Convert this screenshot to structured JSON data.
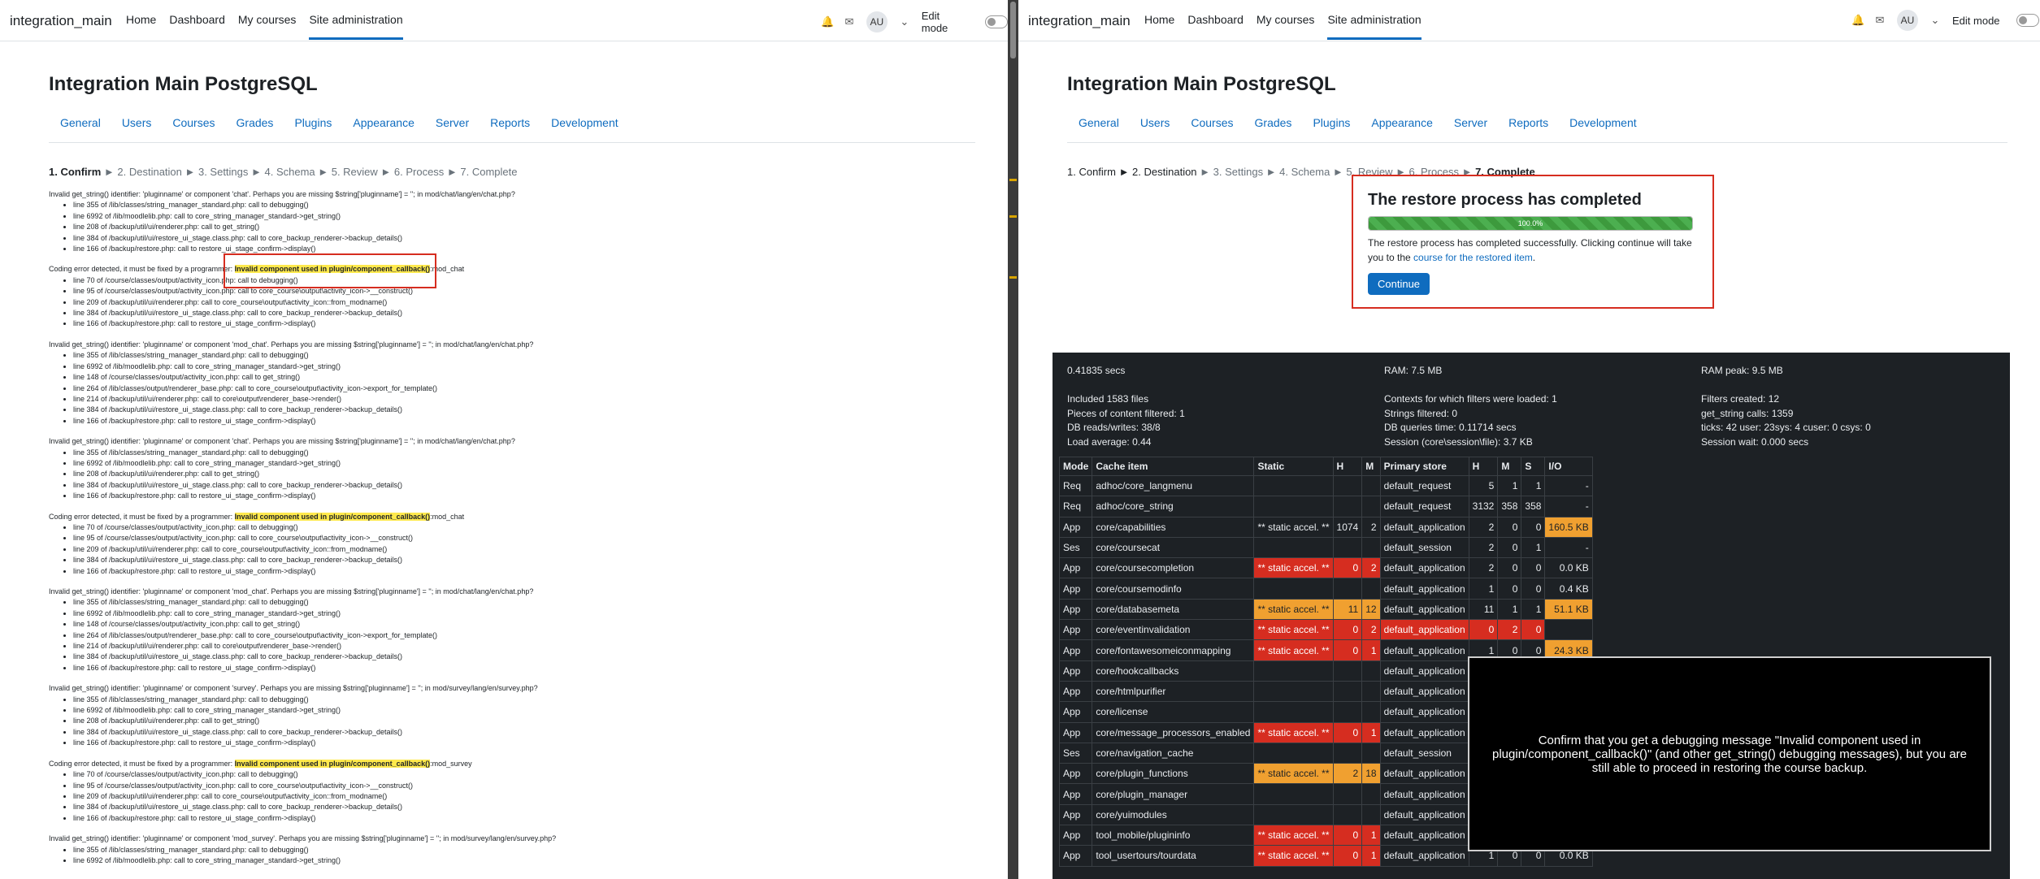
{
  "navbar": {
    "brand": "integration_main",
    "items": [
      "Home",
      "Dashboard",
      "My courses",
      "Site administration"
    ],
    "avatar": "AU",
    "edit_mode": "Edit mode"
  },
  "page_title": "Integration Main PostgreSQL",
  "admin_tabs": [
    "General",
    "Users",
    "Courses",
    "Grades",
    "Plugins",
    "Appearance",
    "Server",
    "Reports",
    "Development"
  ],
  "steps_left": {
    "current": "1. Confirm",
    "rest": " ► 2. Destination ► 3. Settings ► 4. Schema ► 5. Review ► 6. Process ► 7. Complete"
  },
  "steps_right": {
    "done": "1. Confirm ► 2. Destination",
    "rest": " ► 3. Settings ► 4. Schema ► 5. Review ► 6. Process ► ",
    "current": "7. Complete"
  },
  "debug": [
    {
      "msg": "Invalid get_string() identifier: 'pluginname' or component 'chat'. Perhaps you are missing $string['pluginname'] = ''; in mod/chat/lang/en/chat.php?",
      "lines": [
        "line 355 of /lib/classes/string_manager_standard.php: call to debugging()",
        "line 6992 of /lib/moodlelib.php: call to core_string_manager_standard->get_string()",
        "line 208 of /backup/util/ui/renderer.php: call to get_string()",
        "line 384 of /backup/util/ui/restore_ui_stage.class.php: call to core_backup_renderer->backup_details()",
        "line 166 of /backup/restore.php: call to restore_ui_stage_confirm->display()"
      ]
    },
    {
      "pre": "Coding error detected, it must be fixed by a programmer: ",
      "hl": "Invalid component used in plugin/component_callback()",
      "post": ":mod_chat",
      "lines": [
        "line 70 of /course/classes/output/activity_icon.php: call to debugging()",
        "line 95 of /course/classes/output/activity_icon.php: call to core_course\\output\\activity_icon->__construct()",
        "line 209 of /backup/util/ui/renderer.php: call to core_course\\output\\activity_icon::from_modname()",
        "line 384 of /backup/util/ui/restore_ui_stage.class.php: call to core_backup_renderer->backup_details()",
        "line 166 of /backup/restore.php: call to restore_ui_stage_confirm->display()"
      ]
    },
    {
      "msg": "Invalid get_string() identifier: 'pluginname' or component 'mod_chat'. Perhaps you are missing $string['pluginname'] = ''; in mod/chat/lang/en/chat.php?",
      "lines": [
        "line 355 of /lib/classes/string_manager_standard.php: call to debugging()",
        "line 6992 of /lib/moodlelib.php: call to core_string_manager_standard->get_string()",
        "line 148 of /course/classes/output/activity_icon.php: call to get_string()",
        "line 264 of /lib/classes/output/renderer_base.php: call to core_course\\output\\activity_icon->export_for_template()",
        "line 214 of /backup/util/ui/renderer.php: call to core\\output\\renderer_base->render()",
        "line 384 of /backup/util/ui/restore_ui_stage.class.php: call to core_backup_renderer->backup_details()",
        "line 166 of /backup/restore.php: call to restore_ui_stage_confirm->display()"
      ]
    },
    {
      "msg": "Invalid get_string() identifier: 'pluginname' or component 'chat'. Perhaps you are missing $string['pluginname'] = ''; in mod/chat/lang/en/chat.php?",
      "lines": [
        "line 355 of /lib/classes/string_manager_standard.php: call to debugging()",
        "line 6992 of /lib/moodlelib.php: call to core_string_manager_standard->get_string()",
        "line 208 of /backup/util/ui/renderer.php: call to get_string()",
        "line 384 of /backup/util/ui/restore_ui_stage.class.php: call to core_backup_renderer->backup_details()",
        "line 166 of /backup/restore.php: call to restore_ui_stage_confirm->display()"
      ]
    },
    {
      "pre": "Coding error detected, it must be fixed by a programmer: ",
      "hl": "Invalid component used in plugin/component_callback()",
      "post": ":mod_chat",
      "lines": [
        "line 70 of /course/classes/output/activity_icon.php: call to debugging()",
        "line 95 of /course/classes/output/activity_icon.php: call to core_course\\output\\activity_icon->__construct()",
        "line 209 of /backup/util/ui/renderer.php: call to core_course\\output\\activity_icon::from_modname()",
        "line 384 of /backup/util/ui/restore_ui_stage.class.php: call to core_backup_renderer->backup_details()",
        "line 166 of /backup/restore.php: call to restore_ui_stage_confirm->display()"
      ]
    },
    {
      "msg": "Invalid get_string() identifier: 'pluginname' or component 'mod_chat'. Perhaps you are missing $string['pluginname'] = ''; in mod/chat/lang/en/chat.php?",
      "lines": [
        "line 355 of /lib/classes/string_manager_standard.php: call to debugging()",
        "line 6992 of /lib/moodlelib.php: call to core_string_manager_standard->get_string()",
        "line 148 of /course/classes/output/activity_icon.php: call to get_string()",
        "line 264 of /lib/classes/output/renderer_base.php: call to core_course\\output\\activity_icon->export_for_template()",
        "line 214 of /backup/util/ui/renderer.php: call to core\\output\\renderer_base->render()",
        "line 384 of /backup/util/ui/restore_ui_stage.class.php: call to core_backup_renderer->backup_details()",
        "line 166 of /backup/restore.php: call to restore_ui_stage_confirm->display()"
      ]
    },
    {
      "msg": "Invalid get_string() identifier: 'pluginname' or component 'survey'. Perhaps you are missing $string['pluginname'] = ''; in mod/survey/lang/en/survey.php?",
      "lines": [
        "line 355 of /lib/classes/string_manager_standard.php: call to debugging()",
        "line 6992 of /lib/moodlelib.php: call to core_string_manager_standard->get_string()",
        "line 208 of /backup/util/ui/renderer.php: call to get_string()",
        "line 384 of /backup/util/ui/restore_ui_stage.class.php: call to core_backup_renderer->backup_details()",
        "line 166 of /backup/restore.php: call to restore_ui_stage_confirm->display()"
      ]
    },
    {
      "pre": "Coding error detected, it must be fixed by a programmer: ",
      "hl": "Invalid component used in plugin/component_callback()",
      "post": ":mod_survey",
      "lines": [
        "line 70 of /course/classes/output/activity_icon.php: call to debugging()",
        "line 95 of /course/classes/output/activity_icon.php: call to core_course\\output\\activity_icon->__construct()",
        "line 209 of /backup/util/ui/renderer.php: call to core_course\\output\\activity_icon::from_modname()",
        "line 384 of /backup/util/ui/restore_ui_stage.class.php: call to core_backup_renderer->backup_details()",
        "line 166 of /backup/restore.php: call to restore_ui_stage_confirm->display()"
      ]
    },
    {
      "msg": "Invalid get_string() identifier: 'pluginname' or component 'mod_survey'. Perhaps you are missing $string['pluginname'] = ''; in mod/survey/lang/en/survey.php?",
      "lines": [
        "line 355 of /lib/classes/string_manager_standard.php: call to debugging()",
        "line 6992 of /lib/moodlelib.php: call to core_string_manager_standard->get_string()"
      ]
    }
  ],
  "restore": {
    "title": "The restore process has completed",
    "progress": 100,
    "progress_label": "100.0%",
    "text": "The restore process has completed successfully. Clicking continue will take you to the ",
    "link": "course for the restored item",
    "text_end": ".",
    "button": "Continue"
  },
  "perf": {
    "col1": [
      "0.41835 secs",
      "",
      "Included 1583 files",
      "Pieces of content filtered: 1",
      "DB reads/writes: 38/8",
      "Load average: 0.44"
    ],
    "col2": [
      "RAM: 7.5 MB",
      "",
      "Contexts for which filters were loaded: 1",
      "Strings filtered: 0",
      "DB queries time: 0.11714 secs",
      "Session (core\\session\\file): 3.7 KB"
    ],
    "col3": [
      "RAM peak: 9.5 MB",
      "",
      "Filters created: 12",
      "get_string calls: 1359",
      "ticks: 42 user: 23sys: 4 cuser: 0 csys: 0",
      "Session wait: 0.000 secs"
    ]
  },
  "cache": {
    "headers": [
      "Mode",
      "Cache item",
      "Static",
      "H",
      "M",
      "Primary store",
      "H",
      "M",
      "S",
      "I/O"
    ],
    "rows": [
      {
        "mode": "Req",
        "item": "adhoc/core_langmenu",
        "static": "",
        "sh": "",
        "sm": "",
        "store": "default_request",
        "h": "5",
        "m": "1",
        "s": "1",
        "io": "-",
        "st": "",
        "io_c": "",
        "store_c": ""
      },
      {
        "mode": "Req",
        "item": "adhoc/core_string",
        "static": "",
        "sh": "",
        "sm": "",
        "store": "default_request",
        "h": "3132",
        "m": "358",
        "s": "358",
        "io": "-",
        "st": "",
        "io_c": "",
        "store_c": ""
      },
      {
        "mode": "App",
        "item": "core/capabilities",
        "static": "** static accel. **",
        "sh": "1074",
        "sm": "2",
        "store": "default_application",
        "h": "2",
        "m": "0",
        "s": "0",
        "io": "160.5 KB",
        "st": "",
        "io_c": "orange",
        "store_c": ""
      },
      {
        "mode": "Ses",
        "item": "core/coursecat",
        "static": "",
        "sh": "",
        "sm": "",
        "store": "default_session",
        "h": "2",
        "m": "0",
        "s": "1",
        "io": "-",
        "st": "",
        "io_c": "",
        "store_c": ""
      },
      {
        "mode": "App",
        "item": "core/coursecompletion",
        "static": "** static accel. **",
        "sh": "0",
        "sm": "2",
        "store": "default_application",
        "h": "2",
        "m": "0",
        "s": "0",
        "io": "0.0 KB",
        "st": "red",
        "io_c": "",
        "store_c": ""
      },
      {
        "mode": "App",
        "item": "core/coursemodinfo",
        "static": "",
        "sh": "",
        "sm": "",
        "store": "default_application",
        "h": "1",
        "m": "0",
        "s": "0",
        "io": "0.4 KB",
        "st": "",
        "io_c": "",
        "store_c": ""
      },
      {
        "mode": "App",
        "item": "core/databasemeta",
        "static": "** static accel. **",
        "sh": "11",
        "sm": "12",
        "store": "default_application",
        "h": "11",
        "m": "1",
        "s": "1",
        "io": "51.1 KB",
        "st": "orange",
        "io_c": "orange",
        "store_c": ""
      },
      {
        "mode": "App",
        "item": "core/eventinvalidation",
        "static": "** static accel. **",
        "sh": "0",
        "sm": "2",
        "store": "default_application",
        "h": "0",
        "m": "2",
        "s": "0",
        "io": "",
        "st": "red",
        "io_c": "",
        "store_c": "red"
      },
      {
        "mode": "App",
        "item": "core/fontawesomeiconmapping",
        "static": "** static accel. **",
        "sh": "0",
        "sm": "1",
        "store": "default_application",
        "h": "1",
        "m": "0",
        "s": "0",
        "io": "24.3 KB",
        "st": "red",
        "io_c": "orange",
        "store_c": ""
      },
      {
        "mode": "App",
        "item": "core/hookcallbacks",
        "static": "",
        "sh": "",
        "sm": "",
        "store": "default_application",
        "h": "",
        "m": "",
        "s": "",
        "io": "",
        "st": "",
        "io_c": "",
        "store_c": ""
      },
      {
        "mode": "App",
        "item": "core/htmlpurifier",
        "static": "",
        "sh": "",
        "sm": "",
        "store": "default_application",
        "h": "",
        "m": "",
        "s": "",
        "io": "",
        "st": "",
        "io_c": "",
        "store_c": ""
      },
      {
        "mode": "App",
        "item": "core/license",
        "static": "",
        "sh": "",
        "sm": "",
        "store": "default_application",
        "h": "",
        "m": "",
        "s": "",
        "io": "",
        "st": "",
        "io_c": "",
        "store_c": ""
      },
      {
        "mode": "App",
        "item": "core/message_processors_enabled",
        "static": "** static accel. **",
        "sh": "0",
        "sm": "1",
        "store": "default_application",
        "h": "",
        "m": "",
        "s": "",
        "io": "",
        "st": "red",
        "io_c": "",
        "store_c": ""
      },
      {
        "mode": "Ses",
        "item": "core/navigation_cache",
        "static": "",
        "sh": "",
        "sm": "",
        "store": "default_session",
        "h": "",
        "m": "",
        "s": "",
        "io": "",
        "st": "",
        "io_c": "",
        "store_c": ""
      },
      {
        "mode": "App",
        "item": "core/plugin_functions",
        "static": "** static accel. **",
        "sh": "2",
        "sm": "18",
        "store": "default_application",
        "h": "",
        "m": "",
        "s": "",
        "io": "",
        "st": "orange",
        "io_c": "",
        "store_c": ""
      },
      {
        "mode": "App",
        "item": "core/plugin_manager",
        "static": "",
        "sh": "",
        "sm": "",
        "store": "default_application",
        "h": "",
        "m": "",
        "s": "",
        "io": "",
        "st": "",
        "io_c": "",
        "store_c": ""
      },
      {
        "mode": "App",
        "item": "core/yuimodules",
        "static": "",
        "sh": "",
        "sm": "",
        "store": "default_application",
        "h": "",
        "m": "",
        "s": "",
        "io": "",
        "st": "",
        "io_c": "",
        "store_c": ""
      },
      {
        "mode": "App",
        "item": "tool_mobile/plugininfo",
        "static": "** static accel. **",
        "sh": "0",
        "sm": "1",
        "store": "default_application",
        "h": "",
        "m": "",
        "s": "",
        "io": "",
        "st": "red",
        "io_c": "",
        "store_c": ""
      },
      {
        "mode": "App",
        "item": "tool_usertours/tourdata",
        "static": "** static accel. **",
        "sh": "0",
        "sm": "1",
        "store": "default_application",
        "h": "1",
        "m": "0",
        "s": "0",
        "io": "0.0 KB",
        "st": "red",
        "io_c": "",
        "store_c": ""
      }
    ]
  },
  "overlay": "Confirm that you get a debugging message \"Invalid component used in plugin/component_callback()\" (and other get_string() debugging messages), but you are still able to proceed in restoring the course backup.",
  "colors": {
    "accent": "#0f6cbf",
    "highlight": "#ffe94d",
    "error": "#d62d20",
    "warn": "#f0a030",
    "perf_bg": "#1d2125"
  }
}
